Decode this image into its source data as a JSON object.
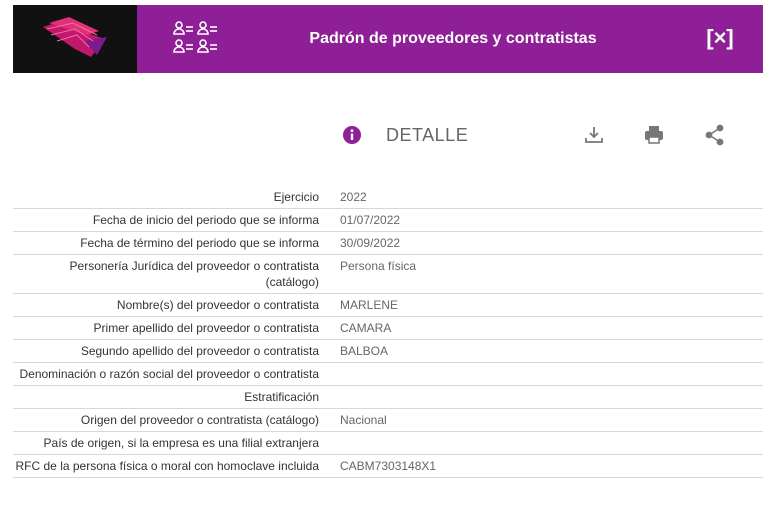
{
  "header": {
    "title": "Padrón de proveedores y contratistas",
    "close_label": "[×]",
    "bg_color": "#8e1f96"
  },
  "toolbar": {
    "title": "DETALLE",
    "icons": [
      "info-icon",
      "download-icon",
      "print-icon",
      "share-icon"
    ]
  },
  "rows": [
    {
      "label": "Ejercicio",
      "value": "2022"
    },
    {
      "label": "Fecha de inicio del periodo que se informa",
      "value": "01/07/2022"
    },
    {
      "label": "Fecha de término del periodo que se informa",
      "value": "30/09/2022"
    },
    {
      "label": "Personería Jurídica del proveedor o contratista (catálogo)",
      "value": "Persona física"
    },
    {
      "label": "Nombre(s) del proveedor o contratista",
      "value": "MARLENE"
    },
    {
      "label": "Primer apellido del proveedor o contratista",
      "value": "CAMARA"
    },
    {
      "label": "Segundo apellido del proveedor o contratista",
      "value": "BALBOA"
    },
    {
      "label": "Denominación o razón social del proveedor o contratista",
      "value": ""
    },
    {
      "label": "Estratificación",
      "value": ""
    },
    {
      "label": "Origen del proveedor o contratista (catálogo)",
      "value": "Nacional"
    },
    {
      "label": "País de origen, si la empresa es una filial extranjera",
      "value": ""
    },
    {
      "label": "RFC de la persona física o moral con homoclave incluida",
      "value": "CABM7303148X1"
    }
  ]
}
